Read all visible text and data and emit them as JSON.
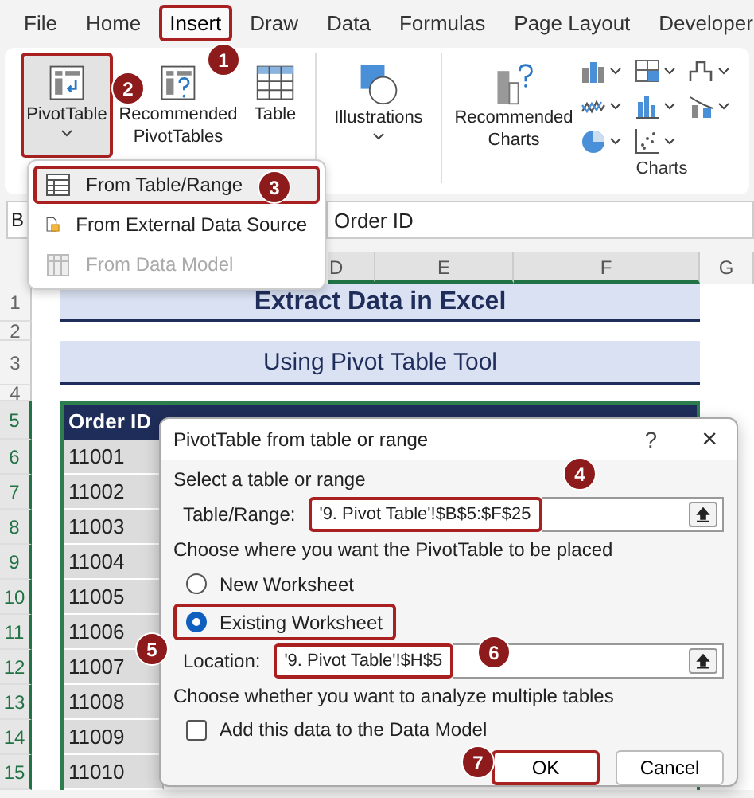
{
  "ribbon_tabs": [
    {
      "label": "File",
      "selected": false,
      "highlighted": false
    },
    {
      "label": "Home",
      "selected": false,
      "highlighted": false
    },
    {
      "label": "Insert",
      "selected": true,
      "highlighted": true
    },
    {
      "label": "Draw",
      "selected": false,
      "highlighted": false
    },
    {
      "label": "Data",
      "selected": false,
      "highlighted": false
    },
    {
      "label": "Formulas",
      "selected": false,
      "highlighted": false
    },
    {
      "label": "Page Layout",
      "selected": false,
      "highlighted": false
    },
    {
      "label": "Developer",
      "selected": false,
      "highlighted": false
    }
  ],
  "ribbon_buttons": [
    {
      "label": "PivotTable",
      "kind": "split",
      "selected": true,
      "highlighted": true
    },
    {
      "label": "Recommended PivotTables",
      "kind": "large",
      "selected": false,
      "highlighted": false
    },
    {
      "label": "Table",
      "kind": "large",
      "selected": false,
      "highlighted": false
    },
    {
      "label": "Illustrations",
      "kind": "dropdown",
      "selected": false,
      "highlighted": false
    },
    {
      "label": "Recommended Charts",
      "kind": "large",
      "selected": false,
      "highlighted": false
    }
  ],
  "ribbon_group_label": "Charts",
  "pivot_menu": [
    {
      "label": "From Table/Range",
      "disabled": false,
      "highlighted": true
    },
    {
      "label": "From External Data Source",
      "disabled": false,
      "highlighted": false
    },
    {
      "label": "From Data Model",
      "disabled": true,
      "highlighted": false
    }
  ],
  "formula_bar": {
    "name_box": "B",
    "formula": "Order ID"
  },
  "column_headers": [
    {
      "label": "D",
      "selected": true
    },
    {
      "label": "E",
      "selected": true
    },
    {
      "label": "F",
      "selected": true
    },
    {
      "label": "G",
      "selected": false
    }
  ],
  "sheet": {
    "title": "Extract Data in Excel",
    "subtitle": "Using Pivot Table Tool",
    "table_header": "Order ID",
    "row_headers": [
      {
        "label": "1",
        "selected": false
      },
      {
        "label": "2",
        "selected": false
      },
      {
        "label": "3",
        "selected": false
      },
      {
        "label": "4",
        "selected": false
      },
      {
        "label": "5",
        "selected": true
      },
      {
        "label": "6",
        "selected": true
      },
      {
        "label": "7",
        "selected": true
      },
      {
        "label": "8",
        "selected": true
      },
      {
        "label": "9",
        "selected": true
      },
      {
        "label": "10",
        "selected": true
      },
      {
        "label": "11",
        "selected": true
      },
      {
        "label": "12",
        "selected": true
      },
      {
        "label": "13",
        "selected": true
      },
      {
        "label": "14",
        "selected": true
      },
      {
        "label": "15",
        "selected": true
      }
    ],
    "order_ids": [
      "11001",
      "11002",
      "11003",
      "11004",
      "11005",
      "11006",
      "11007",
      "11008",
      "11009",
      "11010"
    ]
  },
  "dialog": {
    "title": "PivotTable from table or range",
    "help": "?",
    "close": "×",
    "section_source": "Select a table or range",
    "range_label": "Table/Range:",
    "range_value": "'9. Pivot Table'!$B$5:$F$25",
    "range_highlighted": true,
    "section_placement": "Choose where you want the PivotTable to be placed",
    "placement_options": [
      {
        "label": "New Worksheet",
        "selected": false,
        "highlighted": false
      },
      {
        "label": "Existing Worksheet",
        "selected": true,
        "highlighted": true
      }
    ],
    "location_label": "Location:",
    "location_value": "'9. Pivot Table'!$H$5",
    "location_highlighted": true,
    "section_multiple": "Choose whether you want to analyze multiple tables",
    "data_model_checkbox": {
      "label": "Add this data to the Data Model",
      "checked": false
    },
    "buttons": [
      {
        "label": "OK",
        "highlighted": true
      },
      {
        "label": "Cancel",
        "highlighted": false
      }
    ]
  },
  "callouts": [
    "1",
    "2",
    "3",
    "4",
    "5",
    "6",
    "7"
  ]
}
